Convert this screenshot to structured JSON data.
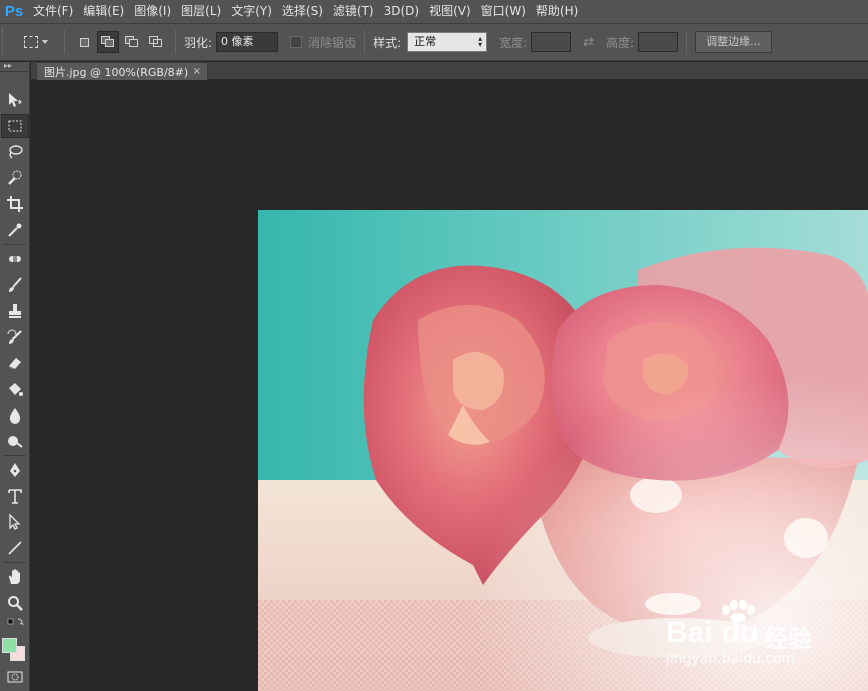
{
  "app": {
    "logo": "Ps"
  },
  "menu": {
    "items": [
      "文件(F)",
      "编辑(E)",
      "图像(I)",
      "图层(L)",
      "文字(Y)",
      "选择(S)",
      "滤镜(T)",
      "3D(D)",
      "视图(V)",
      "窗口(W)",
      "帮助(H)"
    ]
  },
  "options": {
    "feather_label": "羽化:",
    "feather_value": "0 像素",
    "antialias_label": "消除锯齿",
    "style_label": "样式:",
    "style_value": "正常",
    "width_label": "宽度:",
    "width_value": "",
    "height_label": "高度:",
    "height_value": "",
    "refine_edge_label": "调整边缘..."
  },
  "document": {
    "tab_title": "图片.jpg @ 100%(RGB/8#)",
    "close_glyph": "×"
  },
  "watermark": {
    "brand": "Bai",
    "brand_suffix": "经验",
    "url": "jingyan.baidu.com"
  },
  "colors": {
    "foreground": "#8fe0a6",
    "background": "#f6dede",
    "ui_panel": "#535353",
    "workspace": "#282828",
    "accent_logo": "#31a8ff"
  },
  "tools": [
    "move-tool",
    "rectangular-marquee-tool",
    "lasso-tool",
    "quick-selection-tool",
    "crop-tool",
    "eyedropper-tool",
    "spot-healing-brush-tool",
    "brush-tool",
    "clone-stamp-tool",
    "history-brush-tool",
    "eraser-tool",
    "paint-bucket-tool",
    "blur-tool",
    "dodge-tool",
    "pen-tool",
    "type-tool",
    "path-selection-tool",
    "line-tool",
    "hand-tool",
    "zoom-tool"
  ]
}
